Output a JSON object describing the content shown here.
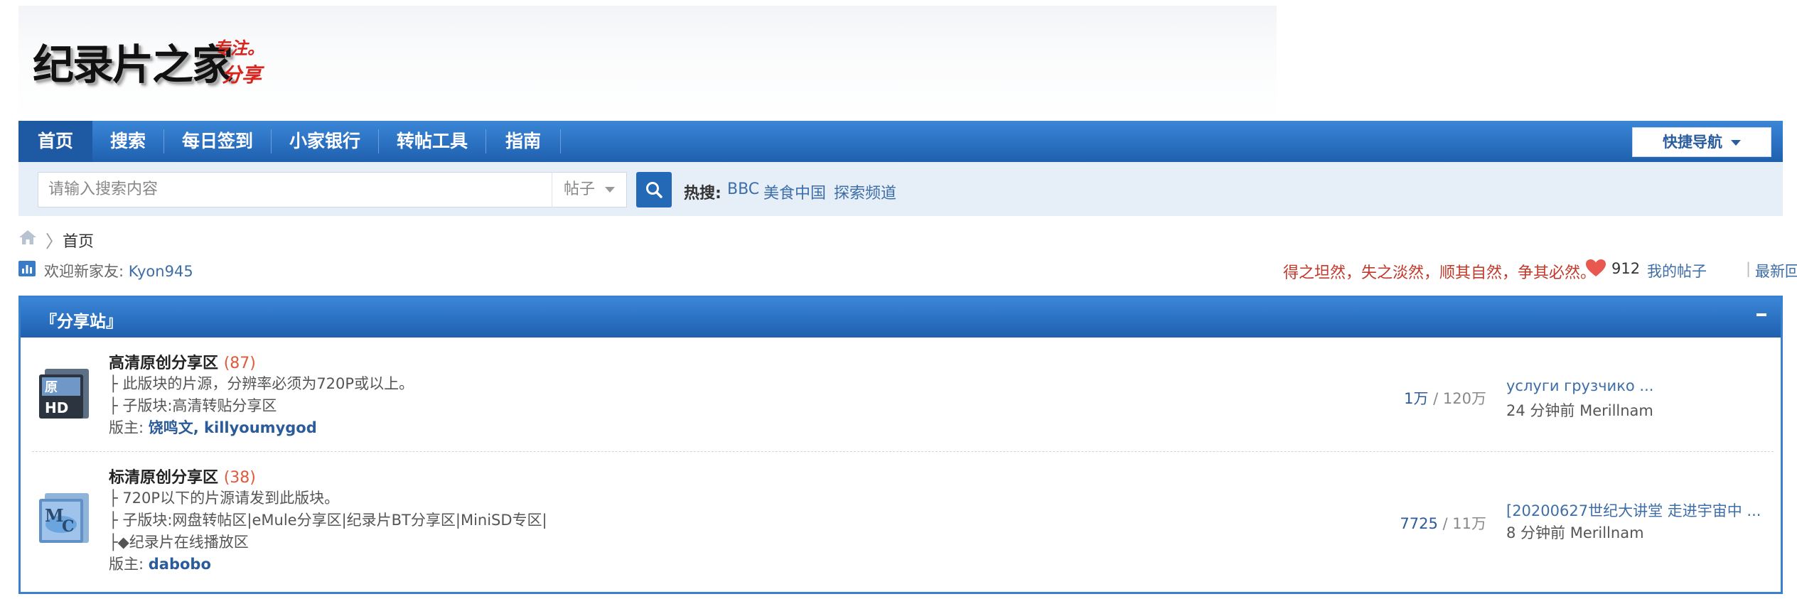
{
  "logo": {
    "main": "纪录片之家",
    "tag_line1": "专注。",
    "tag_line2": "分享"
  },
  "nav": {
    "items": [
      "首页",
      "搜索",
      "每日签到",
      "小家银行",
      "转帖工具",
      "指南"
    ],
    "quick_nav": "快捷导航"
  },
  "search": {
    "placeholder": "请输入搜索内容",
    "type": "帖子",
    "hot_label": "热搜:",
    "hot_links": [
      "BBC",
      "美食中国",
      "探索频道"
    ]
  },
  "breadcrumb": {
    "current": "首页"
  },
  "welcome": {
    "prefix": "欢迎新家友: ",
    "username": "Kyon945",
    "motto": "得之坦然，失之淡然，顺其自然，争其必然。",
    "heart_count": "912",
    "my_posts": "我的帖子",
    "latest_replies": "最新回复"
  },
  "forum": {
    "section_title": "『分享站』",
    "boards": [
      {
        "icon": "hd-folder-icon",
        "name": "高清原创分享区",
        "count": "(87)",
        "lines": [
          "├ 此版块的片源，分辨率必须为720P或以上。",
          "├ 子版块:高清转贴分享区"
        ],
        "mods_label": "版主: ",
        "mods": "饶鸣文, killyoumygod",
        "stats_main": "1万",
        "stats_total": " / 120万",
        "last_title": "услуги грузчико ...",
        "last_meta": "24 分钟前 Merillnam"
      },
      {
        "icon": "mc-folder-icon",
        "name": "标清原创分享区",
        "count": "(38)",
        "lines": [
          "├ 720P以下的片源请发到此版块。",
          "├ 子版块:网盘转帖区|eMule分享区|纪录片BT分享区|MiniSD专区|",
          "├◆纪录片在线播放区"
        ],
        "mods_label": "版主: ",
        "mods": "dabobo",
        "stats_main": "7725",
        "stats_total": " / 11万",
        "last_title": "[20200627世纪大讲堂 走进宇宙中 ...",
        "last_meta": "8 分钟前 Merillnam"
      }
    ]
  },
  "colors": {
    "nav_blue": "#2a6fc0",
    "link_blue": "#3d6ea8",
    "motto_red": "#c0392b",
    "count_red": "#e05a3a"
  }
}
